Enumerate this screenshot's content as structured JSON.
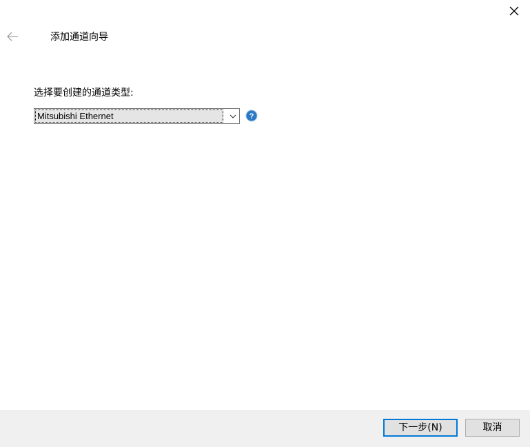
{
  "window": {
    "title": "添加通道向导",
    "close_icon": "close-icon",
    "back_icon": "back-arrow-icon"
  },
  "form": {
    "prompt": "选择要创建的通道类型:",
    "channel_type": {
      "selected": "Mitsubishi Ethernet",
      "dropdown_icon": "chevron-down-icon"
    },
    "help_icon": "help-icon"
  },
  "footer": {
    "next_label": "下一步(N)",
    "cancel_label": "取消"
  },
  "colors": {
    "accent": "#0078d7",
    "footer_bg": "#f0f0f0",
    "help_icon_fill": "#2b79c2"
  }
}
